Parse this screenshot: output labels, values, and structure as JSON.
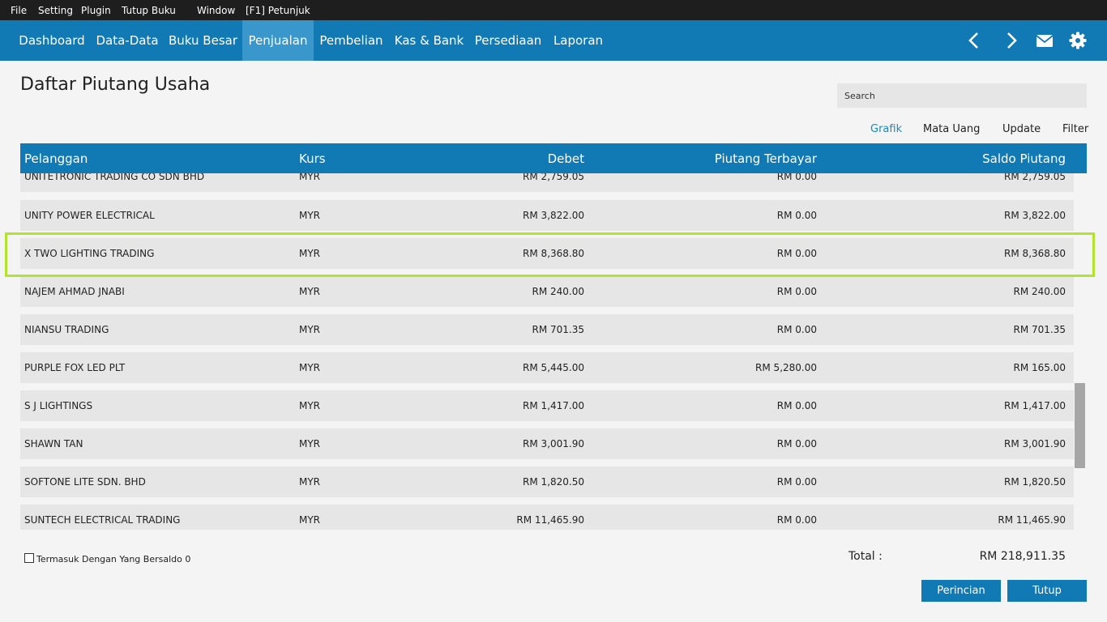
{
  "menu": [
    "File",
    "Setting",
    "Plugin",
    "Tutup Buku",
    "Window",
    "[F1] Petunjuk"
  ],
  "nav": {
    "items": [
      "Dashboard",
      "Data-Data",
      "Buku Besar",
      "Penjualan",
      "Pembelian",
      "Kas & Bank",
      "Persediaan",
      "Laporan"
    ],
    "active": "Penjualan",
    "icons": [
      "chevron-left-icon",
      "chevron-right-icon",
      "mail-icon",
      "gear-icon"
    ]
  },
  "page": {
    "title": "Daftar Piutang Usaha"
  },
  "search": {
    "placeholder": "Search"
  },
  "toolbar": {
    "grafik": "Grafik",
    "mata_uang": "Mata Uang",
    "update": "Update",
    "filter": "Filter"
  },
  "table": {
    "columns": [
      "Pelanggan",
      "Kurs",
      "Debet",
      "Piutang Terbayar",
      "Saldo Piutang"
    ],
    "rows": [
      [
        "UNITETRONIC TRADING CO SDN BHD",
        "MYR",
        "RM 2,759.05",
        "RM 0.00",
        "RM 2,759.05"
      ],
      [
        "UNITY POWER ELECTRICAL",
        "MYR",
        "RM 3,822.00",
        "RM 0.00",
        "RM 3,822.00"
      ],
      [
        "X TWO LIGHTING TRADING",
        "MYR",
        "RM 8,368.80",
        "RM 0.00",
        "RM 8,368.80"
      ],
      [
        "NAJEM AHMAD JNABI",
        "MYR",
        "RM 240.00",
        "RM 0.00",
        "RM 240.00"
      ],
      [
        "NIANSU TRADING",
        "MYR",
        "RM 701.35",
        "RM 0.00",
        "RM 701.35"
      ],
      [
        "PURPLE FOX LED PLT",
        "MYR",
        "RM 5,445.00",
        "RM 5,280.00",
        "RM 165.00"
      ],
      [
        "S J LIGHTINGS",
        "MYR",
        "RM 1,417.00",
        "RM 0.00",
        "RM 1,417.00"
      ],
      [
        "SHAWN TAN",
        "MYR",
        "RM 3,001.90",
        "RM 0.00",
        "RM 3,001.90"
      ],
      [
        "SOFTONE LITE SDN. BHD",
        "MYR",
        "RM 1,820.50",
        "RM 0.00",
        "RM 1,820.50"
      ],
      [
        "SUNTECH ELECTRICAL TRADING",
        "MYR",
        "RM 11,465.90",
        "RM 0.00",
        "RM 11,465.90"
      ]
    ],
    "highlighted_row": "X TWO LIGHTING TRADING"
  },
  "footer": {
    "checkbox_label": "Termasuk Dengan Yang Bersaldo 0",
    "checkbox_checked": false,
    "total_label": "Total :",
    "total_value": "RM 218,911.35",
    "detail_button": "Perincian",
    "close_button": "Tutup"
  },
  "colors": {
    "nav_bg": "#1179b4",
    "nav_active": "#3a97cc",
    "highlight": "#b4e32d",
    "link_active": "#1a88c9"
  }
}
